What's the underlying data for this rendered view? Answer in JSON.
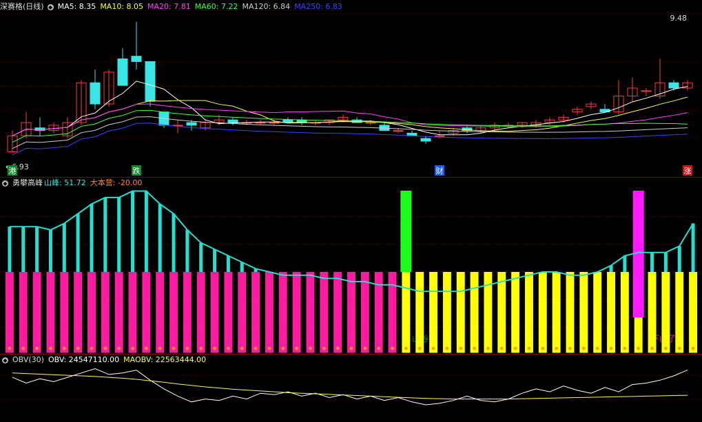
{
  "colors": {
    "up": "#ff3a3a",
    "down": "#39e6e6",
    "ma5": "#ffffff",
    "ma10": "#ffff40",
    "ma20": "#ff40ff",
    "ma60": "#40ff40",
    "ma120": "#cfcfcf",
    "ma250": "#4040ff",
    "pink": "#ff1aa0",
    "yellow": "#ffff00",
    "cyan": "#22e0d0",
    "green": "#1aff1a",
    "magenta": "#ff1aff"
  },
  "price_panel": {
    "title": "深赛格(日线)",
    "indicators": [
      {
        "label": "MA5: 8.35",
        "color": "#ffffff"
      },
      {
        "label": "MA10: 8.05",
        "color": "#ffff40"
      },
      {
        "label": "MA20: 7.81",
        "color": "#ff40ff"
      },
      {
        "label": "MA60: 7.22",
        "color": "#40ff40"
      },
      {
        "label": "MA120: 6.84",
        "color": "#cfcfcf"
      },
      {
        "label": "MA250: 6.83",
        "color": "#4040ff"
      }
    ],
    "high_label": "9.48",
    "low_label": "6.93",
    "markers": [
      {
        "text": "港",
        "idx": 0,
        "bg": "#0a8a2a"
      },
      {
        "text": "跌",
        "idx": 9,
        "bg": "#0a8a2a"
      },
      {
        "text": "财",
        "idx": 31,
        "bg": "#1a5aff"
      },
      {
        "text": "涨",
        "idx": 49,
        "bg": "#cc1111"
      }
    ]
  },
  "osc_panel": {
    "title": "勇攀高峰",
    "values": [
      {
        "label": "山峰: 51.72",
        "color": "#39e6e6"
      },
      {
        "label": "大本营: -20.00",
        "color": "#ff8a2a"
      }
    ],
    "label_valley": "山谷",
    "label_down": "下山了"
  },
  "obv_panel": {
    "title": "OBV(30)",
    "values": [
      {
        "label": "OBV: 24547110.00",
        "color": "#ffffff"
      },
      {
        "label": "MAOBV: 22563444.00",
        "color": "#ffff40"
      }
    ]
  },
  "chart_data": [
    {
      "type": "candlestick",
      "title": "深赛格(日线)",
      "ylim": [
        6.8,
        9.55
      ],
      "ohlc": [
        [
          6.95,
          7.35,
          6.93,
          7.25
        ],
        [
          7.25,
          7.7,
          7.2,
          7.5
        ],
        [
          7.4,
          7.6,
          7.25,
          7.35
        ],
        [
          7.35,
          7.5,
          7.3,
          7.45
        ],
        [
          7.25,
          7.6,
          7.2,
          7.5
        ],
        [
          7.5,
          8.3,
          7.45,
          8.25
        ],
        [
          8.25,
          8.5,
          7.75,
          7.85
        ],
        [
          7.85,
          8.5,
          7.8,
          8.45
        ],
        [
          8.7,
          8.9,
          8.2,
          8.2
        ],
        [
          8.75,
          9.4,
          8.5,
          8.65
        ],
        [
          8.65,
          8.65,
          7.8,
          7.9
        ],
        [
          7.7,
          7.7,
          7.4,
          7.45
        ],
        [
          7.45,
          7.55,
          7.3,
          7.45
        ],
        [
          7.5,
          7.55,
          7.35,
          7.45
        ],
        [
          7.4,
          7.55,
          7.35,
          7.5
        ],
        [
          7.5,
          7.65,
          7.45,
          7.55
        ],
        [
          7.55,
          7.6,
          7.45,
          7.5
        ],
        [
          7.5,
          7.55,
          7.45,
          7.5
        ],
        [
          7.5,
          7.55,
          7.45,
          7.5
        ],
        [
          7.5,
          7.55,
          7.45,
          7.5
        ],
        [
          7.55,
          7.6,
          7.5,
          7.5
        ],
        [
          7.55,
          7.6,
          7.45,
          7.5
        ],
        [
          7.5,
          7.55,
          7.45,
          7.5
        ],
        [
          7.5,
          7.55,
          7.45,
          7.55
        ],
        [
          7.55,
          7.65,
          7.5,
          7.6
        ],
        [
          7.55,
          7.6,
          7.5,
          7.5
        ],
        [
          7.5,
          7.55,
          7.45,
          7.5
        ],
        [
          7.45,
          7.5,
          7.4,
          7.35
        ],
        [
          7.35,
          7.4,
          7.3,
          7.35
        ],
        [
          7.3,
          7.35,
          7.25,
          7.25
        ],
        [
          7.2,
          7.25,
          7.1,
          7.15
        ],
        [
          7.25,
          7.35,
          7.2,
          7.25
        ],
        [
          7.3,
          7.4,
          7.25,
          7.35
        ],
        [
          7.4,
          7.45,
          7.3,
          7.35
        ],
        [
          7.35,
          7.45,
          7.3,
          7.4
        ],
        [
          7.4,
          7.5,
          7.35,
          7.45
        ],
        [
          7.45,
          7.5,
          7.4,
          7.45
        ],
        [
          7.45,
          7.5,
          7.4,
          7.5
        ],
        [
          7.45,
          7.55,
          7.4,
          7.5
        ],
        [
          7.5,
          7.6,
          7.45,
          7.55
        ],
        [
          7.55,
          7.65,
          7.5,
          7.6
        ],
        [
          7.7,
          7.8,
          7.65,
          7.75
        ],
        [
          7.8,
          7.9,
          7.75,
          7.85
        ],
        [
          7.75,
          7.85,
          7.7,
          7.7
        ],
        [
          7.7,
          8.3,
          7.65,
          8.0
        ],
        [
          8.0,
          8.35,
          7.9,
          8.15
        ],
        [
          8.1,
          8.15,
          8.0,
          8.1
        ],
        [
          8.0,
          8.7,
          7.95,
          8.25
        ],
        [
          8.25,
          8.3,
          8.1,
          8.15
        ],
        [
          8.15,
          8.3,
          8.1,
          8.25
        ]
      ]
    },
    {
      "type": "bar",
      "title": "勇攀高峰",
      "series": [
        {
          "name": "山峰",
          "values": [
            14,
            14,
            14,
            13,
            15,
            18,
            21,
            23,
            23,
            25,
            25,
            21,
            18,
            13,
            9,
            7,
            5,
            3,
            1,
            0,
            -1,
            -1,
            -1,
            -2,
            -2,
            -3,
            -3,
            -4,
            -4,
            -5,
            -6,
            -6,
            -6,
            -6,
            -5,
            -4,
            -3,
            -2,
            -1,
            0,
            0,
            -1,
            -1,
            0,
            2,
            5,
            6,
            6,
            6,
            8,
            15
          ]
        },
        {
          "name": "大本营",
          "values": [
            -20,
            -20,
            -20,
            -20,
            -20,
            -20,
            -20,
            -20,
            -20,
            -20,
            -20,
            -20,
            -20,
            -20,
            -20,
            -20,
            -20,
            -20,
            -20,
            -20,
            -20,
            -20,
            -20,
            -20,
            -20,
            -20,
            -20,
            -20,
            -20,
            -20,
            -20,
            -20,
            -20,
            -20,
            -20,
            -20,
            -20,
            -20,
            -20,
            -20,
            -20,
            -20,
            -20,
            -20,
            -20,
            -20,
            -20,
            -20,
            -20,
            -20,
            -20
          ]
        }
      ]
    },
    {
      "type": "line",
      "title": "OBV(30)",
      "series": [
        {
          "name": "OBV",
          "values": [
            0.45,
            0.25,
            0.4,
            0.3,
            0.45,
            0.6,
            0.75,
            0.55,
            0.6,
            0.7,
            0.35,
            0.05,
            -0.2,
            -0.4,
            -0.3,
            -0.35,
            -0.2,
            -0.3,
            -0.1,
            -0.15,
            -0.05,
            -0.2,
            -0.1,
            -0.25,
            -0.15,
            -0.3,
            -0.2,
            -0.35,
            -0.25,
            -0.4,
            -0.5,
            -0.45,
            -0.35,
            -0.2,
            -0.35,
            -0.4,
            -0.3,
            -0.1,
            0.05,
            -0.05,
            0.15,
            0.0,
            -0.1,
            0.1,
            -0.05,
            0.2,
            0.25,
            0.35,
            0.5,
            0.7
          ]
        },
        {
          "name": "MAOBV",
          "values": [
            0.6,
            0.58,
            0.56,
            0.54,
            0.52,
            0.5,
            0.48,
            0.45,
            0.42,
            0.38,
            0.33,
            0.28,
            0.22,
            0.17,
            0.12,
            0.08,
            0.04,
            0.01,
            -0.02,
            -0.05,
            -0.08,
            -0.1,
            -0.12,
            -0.14,
            -0.16,
            -0.18,
            -0.2,
            -0.22,
            -0.24,
            -0.26,
            -0.28,
            -0.29,
            -0.3,
            -0.3,
            -0.3,
            -0.3,
            -0.3,
            -0.29,
            -0.28,
            -0.27,
            -0.26,
            -0.25,
            -0.24,
            -0.23,
            -0.22,
            -0.21,
            -0.2,
            -0.19,
            -0.18,
            -0.17
          ]
        }
      ]
    }
  ]
}
